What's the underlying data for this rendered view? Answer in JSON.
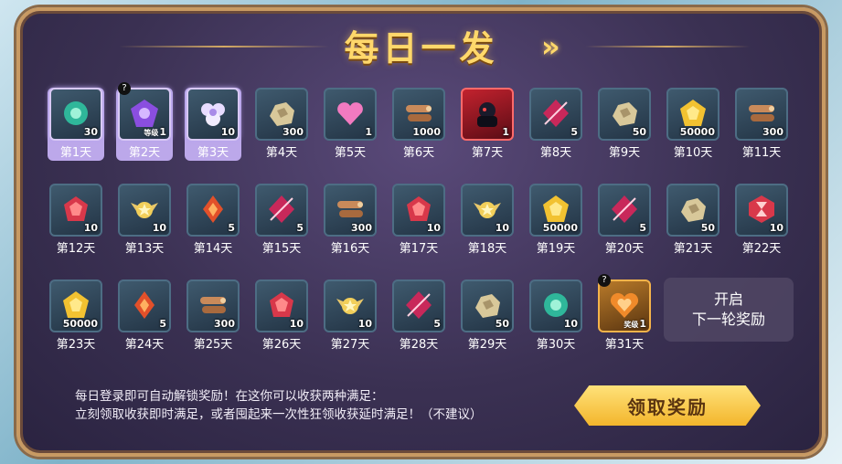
{
  "title": "每日一发",
  "next_arrow_icon": "double-chevron-right-icon",
  "next_round": {
    "line1": "开启",
    "line2": "下一轮奖励"
  },
  "description": {
    "line1": "每日登录即可自动解锁奖励！在这你可以收获两种满足：",
    "line2": "立刻领取收获即时满足，或者囤起来一次性狂领收获延时满足！（不建议）"
  },
  "claim_button": "领取奖励",
  "colors": {
    "accent_gold": "#ffd86b",
    "claimed_highlight": "#bca8ea",
    "panel_bg": "#3b3153"
  },
  "days": [
    {
      "label": "第1天",
      "qty": "30",
      "icon": "green-gem-icon",
      "state": "claimed"
    },
    {
      "label": "第2天",
      "qty": "1",
      "sublabel": "等级",
      "icon": "purple-emblem-icon",
      "state": "claimed",
      "mystery": true
    },
    {
      "label": "第3天",
      "qty": "10",
      "icon": "white-flower-icon",
      "state": "claimed"
    },
    {
      "label": "第4天",
      "qty": "300",
      "icon": "ore-chunk-icon"
    },
    {
      "label": "第5天",
      "qty": "1",
      "icon": "pink-heart-icon"
    },
    {
      "label": "第6天",
      "qty": "1000",
      "icon": "log-bundle-icon"
    },
    {
      "label": "第7天",
      "qty": "1",
      "icon": "dark-hero-portrait-icon",
      "state": "special"
    },
    {
      "label": "第8天",
      "qty": "5",
      "icon": "red-crystal-icon"
    },
    {
      "label": "第9天",
      "qty": "50",
      "icon": "ore-chunk-icon"
    },
    {
      "label": "第10天",
      "qty": "50000",
      "icon": "gold-coin-icon"
    },
    {
      "label": "第11天",
      "qty": "300",
      "icon": "log-bundle-icon"
    },
    {
      "label": "第12天",
      "qty": "10",
      "icon": "red-gem-icon"
    },
    {
      "label": "第13天",
      "qty": "10",
      "icon": "winged-star-icon"
    },
    {
      "label": "第14天",
      "qty": "5",
      "icon": "fire-crystal-icon"
    },
    {
      "label": "第15天",
      "qty": "5",
      "icon": "red-crystal-icon"
    },
    {
      "label": "第16天",
      "qty": "300",
      "icon": "log-bundle-icon"
    },
    {
      "label": "第17天",
      "qty": "10",
      "icon": "red-gem-icon"
    },
    {
      "label": "第18天",
      "qty": "10",
      "icon": "winged-star-icon"
    },
    {
      "label": "第19天",
      "qty": "50000",
      "icon": "gold-coin-icon"
    },
    {
      "label": "第20天",
      "qty": "5",
      "icon": "red-crystal-icon"
    },
    {
      "label": "第21天",
      "qty": "50",
      "icon": "ore-chunk-icon"
    },
    {
      "label": "第22天",
      "qty": "10",
      "icon": "hourglass-badge-icon"
    },
    {
      "label": "第23天",
      "qty": "50000",
      "icon": "gold-coin-icon"
    },
    {
      "label": "第24天",
      "qty": "5",
      "icon": "fire-crystal-icon"
    },
    {
      "label": "第25天",
      "qty": "300",
      "icon": "log-bundle-icon"
    },
    {
      "label": "第26天",
      "qty": "10",
      "icon": "red-gem-icon"
    },
    {
      "label": "第27天",
      "qty": "10",
      "icon": "winged-star-icon"
    },
    {
      "label": "第28天",
      "qty": "5",
      "icon": "red-crystal-icon"
    },
    {
      "label": "第29天",
      "qty": "50",
      "icon": "ore-chunk-icon"
    },
    {
      "label": "第30天",
      "qty": "10",
      "icon": "green-gem-icon"
    },
    {
      "label": "第31天",
      "qty": "1",
      "sublabel": "奖级",
      "icon": "orange-crest-icon",
      "state": "gold",
      "mystery": true
    }
  ]
}
